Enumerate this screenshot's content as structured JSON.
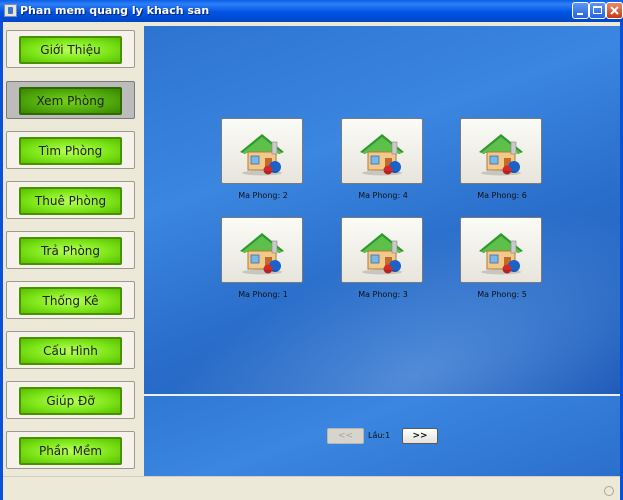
{
  "window": {
    "title": "Phan mem quang ly khach san"
  },
  "sidebar": {
    "items": [
      {
        "label": "Giới Thiệu",
        "active": false
      },
      {
        "label": "Xem Phòng",
        "active": true
      },
      {
        "label": "Tìm Phòng",
        "active": false
      },
      {
        "label": "Thuê Phòng",
        "active": false
      },
      {
        "label": "Trả Phòng",
        "active": false
      },
      {
        "label": "Thống Kê",
        "active": false
      },
      {
        "label": "Cấu Hình",
        "active": false
      },
      {
        "label": "Giúp Đỡ",
        "active": false
      },
      {
        "label": "Phần Mềm",
        "active": false
      }
    ]
  },
  "rooms": [
    {
      "label": "Ma Phong: 2",
      "icon": "house-icon"
    },
    {
      "label": "Ma Phong: 4",
      "icon": "house-icon"
    },
    {
      "label": "Ma Phong: 6",
      "icon": "house-icon"
    },
    {
      "label": "Ma Phong: 1",
      "icon": "house-icon"
    },
    {
      "label": "Ma Phong: 3",
      "icon": "house-icon"
    },
    {
      "label": "Ma Phong: 5",
      "icon": "house-icon"
    }
  ],
  "pagination": {
    "prev_label": "<<",
    "floor_label": "Lầu:1",
    "next_label": ">>"
  },
  "colors": {
    "titlebar": "#0054e3",
    "menu_green": "#7fe61a",
    "panel_blue": "#2d74d0"
  }
}
